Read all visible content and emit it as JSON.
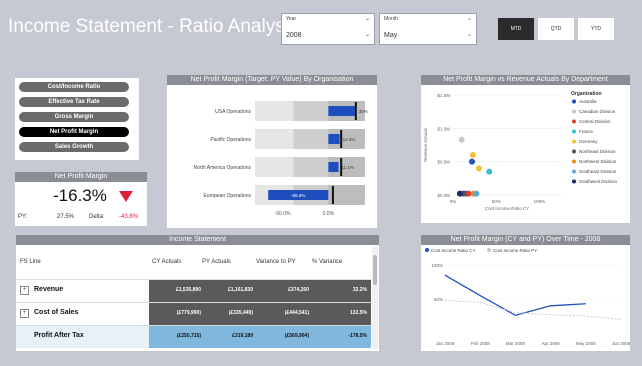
{
  "page": {
    "title": "Income Statement - Ratio Analysis"
  },
  "slicers": {
    "year": {
      "label": "Year",
      "value": "2008"
    },
    "month": {
      "label": "Month",
      "value": "May"
    }
  },
  "period_buttons": [
    {
      "label": "MTD",
      "active": true
    },
    {
      "label": "QTD",
      "active": false
    },
    {
      "label": "YTD",
      "active": false
    }
  ],
  "ratio_buttons": [
    {
      "label": "Cost/Income Ratio",
      "active": false
    },
    {
      "label": "Effective Tax Rate",
      "active": false
    },
    {
      "label": "Gross Margin",
      "active": false
    },
    {
      "label": "Net Profit Margin",
      "active": true
    },
    {
      "label": "Sales Growth",
      "active": false
    }
  ],
  "kpi": {
    "title": "Net Profit Margin",
    "value": "-16.3%",
    "py_label": "PY:",
    "py_value": "27.5%",
    "delta_label": "Delta:",
    "delta_value": "-43.8%"
  },
  "charts": {
    "bullet": {
      "title": "Net Profit Margin (Target: PY Value) By Organisation",
      "axis_labels": [
        "-50.0%",
        "0.0%"
      ]
    },
    "scatter": {
      "title": "Net Profit Margin vs Revenue Actuals By Department",
      "ylabel": "Revenue Actuals",
      "xlabel": "Cost Income Ratio CY",
      "y_ticks": [
        "$1.5M",
        "$1.0M",
        "$0.5M",
        "$0.0M"
      ],
      "x_ticks": [
        "0%",
        "50%",
        "100%"
      ],
      "legend_title": "Organization"
    },
    "line": {
      "title": "Net Profit Margin (CY and PY) Over Time - 2008",
      "legend": [
        "Cost Income Ratio CY",
        "Cost Income Ratio PY"
      ],
      "y_ticks": [
        "100%",
        "50%"
      ],
      "x_ticks": [
        "Jan 2008",
        "Feb 2008",
        "Mar 2008",
        "Apr 2008",
        "May 2008",
        "Jun 2008"
      ]
    }
  },
  "chart_data": [
    {
      "type": "bar",
      "title": "Net Profit Margin (Target: PY Value) By Organisation",
      "categories": [
        "USA Operations",
        "Pacific Operations",
        "North America Operations",
        "European Operations"
      ],
      "values": [
        30.0,
        12.3,
        11.1,
        -65.6
      ],
      "value_labels": [
        "30%",
        "12.3%",
        "11.1%",
        "-65.6%"
      ],
      "targets": [
        30.0,
        14.0,
        14.0,
        5.0
      ],
      "xlim": [
        -80,
        40
      ]
    },
    {
      "type": "scatter",
      "title": "Net Profit Margin vs Revenue Actuals By Department",
      "xlabel": "Cost Income Ratio CY",
      "ylabel": "Revenue Actuals",
      "xlim": [
        0,
        125
      ],
      "ylim": [
        0,
        1.5
      ],
      "series": [
        {
          "name": "Australia",
          "color": "#1f4fbf",
          "points": [
            [
              15,
              0.02
            ],
            [
              22,
              0.5
            ]
          ]
        },
        {
          "name": "Canadian Division",
          "color": "#c8c8c8",
          "points": [
            [
              10,
              0.83
            ]
          ]
        },
        {
          "name": "Central Division",
          "color": "#e0402a",
          "points": [
            [
              18,
              0.02
            ]
          ]
        },
        {
          "name": "France",
          "color": "#2fbfcf",
          "points": [
            [
              42,
              0.35
            ]
          ]
        },
        {
          "name": "Germany",
          "color": "#f2c12e",
          "points": [
            [
              23,
              0.6
            ],
            [
              30,
              0.4
            ]
          ]
        },
        {
          "name": "Northeast Division",
          "color": "#555555",
          "points": [
            [
              12,
              0.02
            ]
          ]
        },
        {
          "name": "Northwest Division",
          "color": "#f08a1a",
          "points": [
            [
              24,
              0.02
            ]
          ]
        },
        {
          "name": "Southeast Division",
          "color": "#5aa7e0",
          "points": [
            [
              27,
              0.02
            ]
          ]
        },
        {
          "name": "Southwest Division",
          "color": "#1a2a6a",
          "points": [
            [
              8,
              0.02
            ]
          ]
        }
      ]
    },
    {
      "type": "line",
      "title": "Net Profit Margin (CY and PY) Over Time - 2008",
      "categories": [
        "Jan 2008",
        "Feb 2008",
        "Mar 2008",
        "Apr 2008",
        "May 2008",
        "Jun 2008"
      ],
      "ylim": [
        0,
        100
      ],
      "series": [
        {
          "name": "Cost Income Ratio CY",
          "values": [
            85,
            55,
            26,
            40,
            43,
            null
          ]
        },
        {
          "name": "Cost Income Ratio PY",
          "values": [
            48,
            45,
            30,
            27,
            25,
            20
          ]
        }
      ]
    }
  ],
  "table": {
    "title": "Income Statement",
    "columns": [
      "FS Line",
      "CY Actuals",
      "PY Actuals",
      "Variance to PY",
      "% Variance"
    ],
    "rows": [
      {
        "expand": "+",
        "label": "Revenue",
        "values": [
          "£1,535,890",
          "£1,161,830",
          "£374,260",
          "32.2%"
        ]
      },
      {
        "expand": "+",
        "label": "Cost of Sales",
        "values": [
          "(£779,990)",
          "(£335,449)",
          "(£444,541)",
          "132.5%"
        ]
      },
      {
        "expand": "",
        "label": "Profit After Tax",
        "values": [
          "(£250,715)",
          "£319,189",
          "(£569,904)",
          "-178.5%"
        ]
      }
    ]
  },
  "colors": {
    "accent_blue": "#1f4fbf",
    "negative_red": "#e0203a",
    "highlight_row": "#7fb7dd",
    "dark_cell": "#5a5a5a"
  }
}
